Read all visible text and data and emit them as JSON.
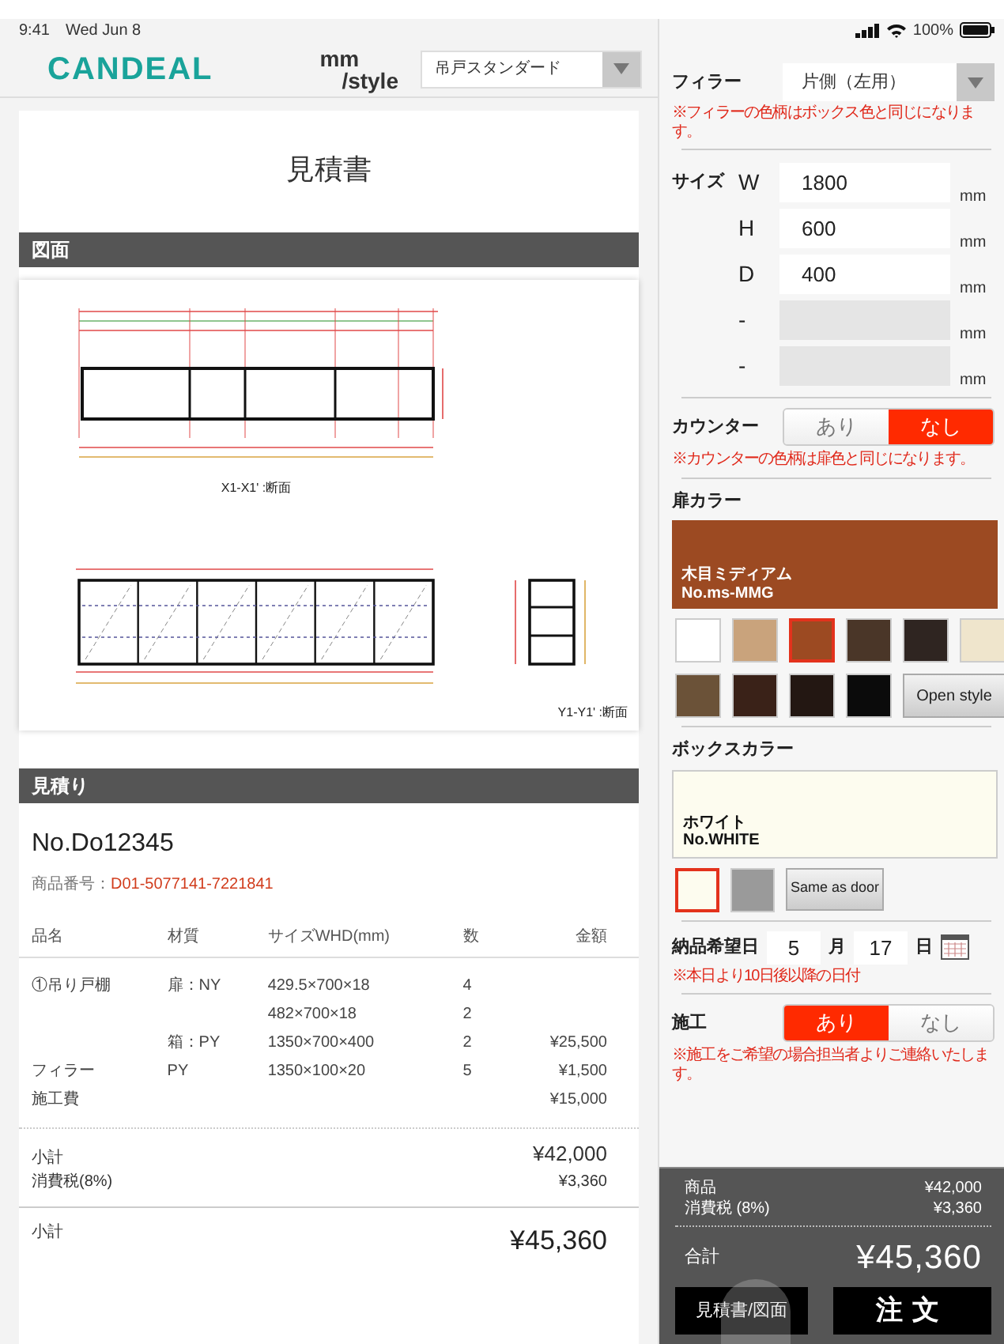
{
  "status_bar": {
    "time": "9:41",
    "date": "Wed Jun 8",
    "battery": "100%"
  },
  "header": {
    "logo": "CANDEAL",
    "brand_top": "mm",
    "brand_bottom": "/style",
    "product_select": {
      "value": "吊戸スタンダード"
    }
  },
  "document": {
    "title": "見積書",
    "drawing_section": {
      "heading": "図面",
      "captions": [
        "X1-X1' :断面",
        "Y1-Y1' :断面"
      ]
    },
    "estimate_section": {
      "heading": "見積り",
      "number": "No.Do12345",
      "product_code_label": "商品番号：",
      "product_code": "D01-5077141-7221841"
    },
    "table": {
      "columns": [
        "品名",
        "材質",
        "サイズWHD(mm)",
        "数",
        "金額"
      ],
      "rows": [
        {
          "name": "①吊り戸棚",
          "material": "扉：NY",
          "size": "429.5×700×18",
          "qty": "4"
        },
        {
          "size": "482×700×18",
          "qty": "2"
        },
        {
          "material": "箱：PY",
          "size": "1350×700×400",
          "qty": "2",
          "amount": "¥25,500"
        },
        {
          "name": "フィラー",
          "material": "PY",
          "size": "1350×100×20",
          "qty": "5",
          "amount": "¥1,500"
        },
        {
          "name": "施工費",
          "amount": "¥15,000"
        }
      ]
    },
    "subtotals": [
      {
        "label": "小計",
        "value": "¥42,000"
      },
      {
        "label": "消費税(8%)",
        "value": "¥3,360"
      }
    ],
    "total": {
      "label": "小計",
      "value": "¥45,360"
    }
  },
  "options": {
    "filler": {
      "label": "フィラー",
      "value": "片側（左用）",
      "note": "※フィラーの色柄はボックス色と同じになります。"
    },
    "size": {
      "label": "サイズ",
      "fields": [
        {
          "axis": "W",
          "value": "1800",
          "unit": "mm",
          "disabled": false
        },
        {
          "axis": "H",
          "value": "600",
          "unit": "mm",
          "disabled": false
        },
        {
          "axis": "D",
          "value": "400",
          "unit": "mm",
          "disabled": false
        },
        {
          "axis": "-",
          "unit": "mm",
          "disabled": true
        },
        {
          "axis": "-",
          "unit": "mm",
          "disabled": true
        }
      ]
    },
    "counter": {
      "label": "カウンター",
      "options": [
        {
          "label": "あり",
          "selected": false
        },
        {
          "label": "なし",
          "selected": true
        }
      ],
      "note": "※カウンターの色柄は扉色と同じになります。"
    },
    "door_color": {
      "label": "扉カラー",
      "preview": {
        "name": "木目ミディアム",
        "code": "No.ms-MMG"
      },
      "swatches": [
        {
          "color": "#ffffff",
          "selected": false
        },
        {
          "color": "#c9a37c",
          "selected": false
        },
        {
          "color": "#9c4a22",
          "selected": true
        },
        {
          "color": "#4a3628",
          "selected": false
        },
        {
          "color": "#2f2521",
          "selected": false
        },
        {
          "color": "#efe5cc",
          "selected": false
        },
        {
          "color": "#6b5238",
          "selected": false
        },
        {
          "color": "#3a2218",
          "selected": false
        },
        {
          "color": "#231712",
          "selected": false
        },
        {
          "color": "#0b0b0b",
          "selected": false
        }
      ],
      "button": "Open style"
    },
    "box_color": {
      "label": "ボックスカラー",
      "preview": {
        "name": "ホワイト",
        "code": "No.WHITE"
      },
      "swatches": [
        {
          "color": "#fdfcef",
          "selected": true
        },
        {
          "color": "#9a9a9a",
          "selected": false
        }
      ],
      "button": "Same as door"
    },
    "delivery": {
      "label": "納品希望日",
      "month": "5",
      "month_unit": "月",
      "day": "17",
      "day_unit": "日",
      "note": "※本日より10日後以降の日付"
    },
    "construction": {
      "label": "施工",
      "options": [
        {
          "label": "あり",
          "selected": true
        },
        {
          "label": "なし",
          "selected": false
        }
      ],
      "note": "※施工をご希望の場合担当者よりご連絡いたします。"
    }
  },
  "summary": {
    "lines": [
      {
        "label": "商品",
        "value": "¥42,000"
      },
      {
        "label": "消費税 (8%)",
        "value": "¥3,360"
      }
    ],
    "total_label": "合計",
    "total": "¥45,360",
    "buttons": [
      "見積書/図面",
      "注文"
    ]
  }
}
